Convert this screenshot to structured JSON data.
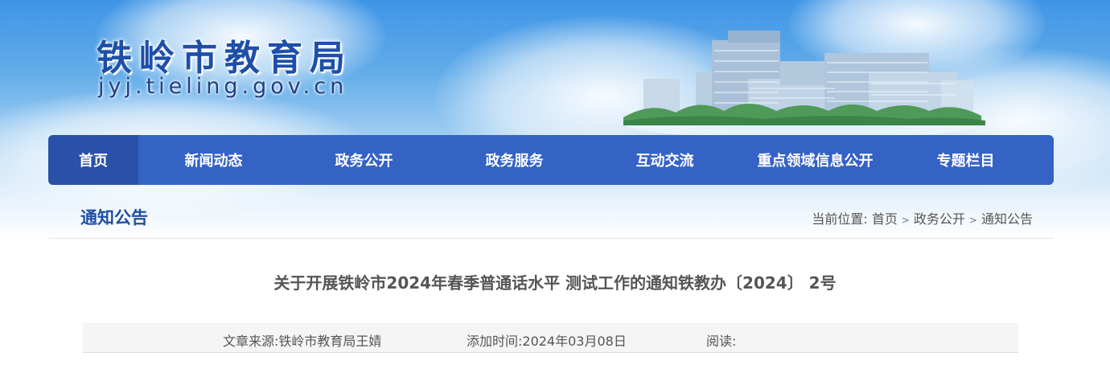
{
  "header": {
    "site_title": "铁岭市教育局",
    "site_domain": "jyj.tieling.gov.cn"
  },
  "nav": {
    "items": [
      {
        "label": "首页",
        "active": true
      },
      {
        "label": "新闻动态"
      },
      {
        "label": "政务公开"
      },
      {
        "label": "政务服务"
      },
      {
        "label": "互动交流"
      },
      {
        "label": "重点领域信息公开"
      },
      {
        "label": "专题栏目"
      }
    ]
  },
  "section": {
    "title": "通知公告",
    "breadcrumb": {
      "prefix": "当前位置:",
      "items": [
        "首页",
        "政务公开",
        "通知公告"
      ],
      "separator": ">"
    }
  },
  "article": {
    "title": "关于开展铁岭市2024年春季普通话水平 测试工作的通知铁教办〔2024〕 2号",
    "source": "文章来源:铁岭市教育局王婧",
    "date": "添加时间:2024年03月08日",
    "reads": "阅读:"
  },
  "colors": {
    "nav_bg": "#3562c5",
    "nav_active": "#2a51a8",
    "accent_title": "#1f4fa5"
  }
}
